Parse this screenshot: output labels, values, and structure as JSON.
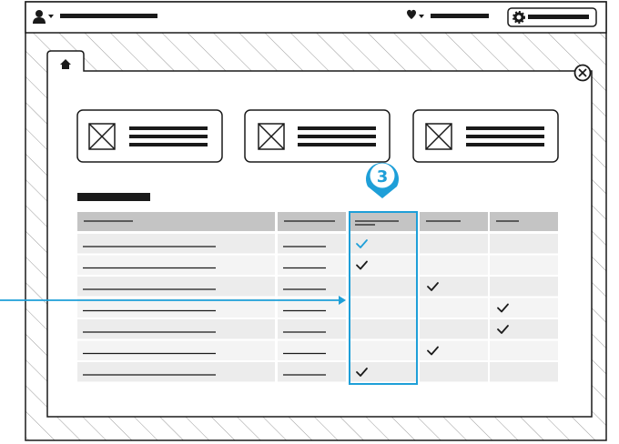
{
  "colors": {
    "ink": "#1a1a1a",
    "accent": "#1e9fd8",
    "header_gray": "#c4c4c4",
    "row_gray": "#ececec",
    "hatch": "#9a9a9a",
    "panel": "#ffffff"
  },
  "icons": {
    "user": "user-icon",
    "heart": "heart-icon",
    "settings": "gear-icon",
    "home": "home-icon",
    "close": "close-icon",
    "image": "image-placeholder-icon",
    "check": "checkmark-icon"
  },
  "callout": {
    "number": "3"
  },
  "table": {
    "checks": [
      [
        1,
        0,
        0
      ],
      [
        1,
        0,
        0
      ],
      [
        0,
        1,
        0
      ],
      [
        0,
        0,
        1
      ],
      [
        0,
        0,
        1
      ],
      [
        0,
        1,
        0
      ],
      [
        1,
        0,
        0
      ]
    ],
    "accent_check": [
      0,
      0
    ]
  }
}
